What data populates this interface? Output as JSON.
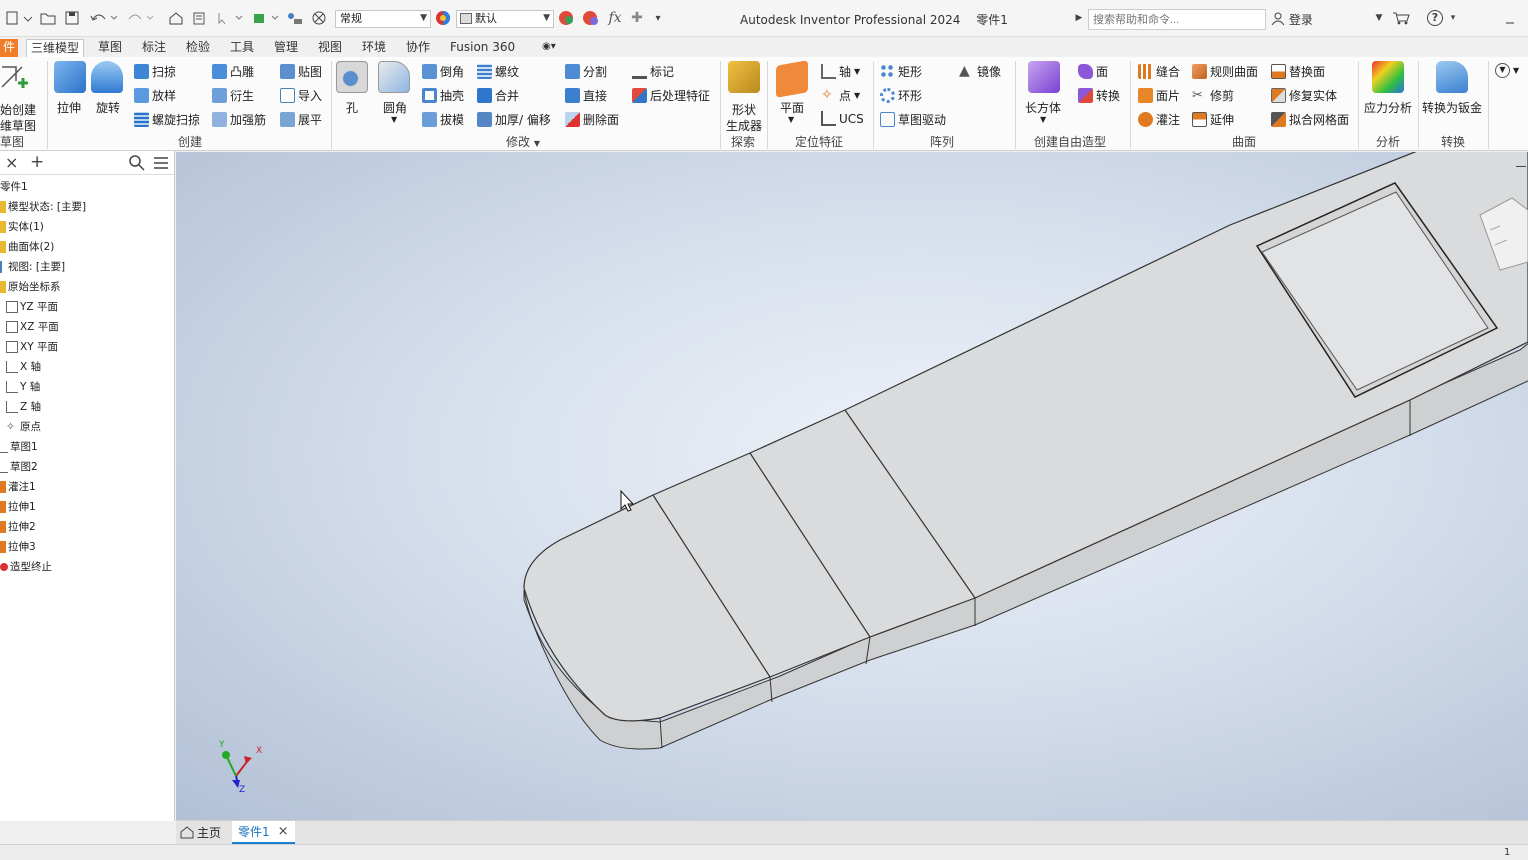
{
  "title": {
    "app": "Autodesk Inventor Professional 2024",
    "doc": "零件1"
  },
  "quick_access": {
    "appearance_combo": "常规",
    "material_combo": "默认",
    "search_placeholder": "搜索帮助和命令...",
    "login": "登录",
    "help": "?"
  },
  "tabs": [
    "件",
    "三维模型",
    "草图",
    "标注",
    "检验",
    "工具",
    "管理",
    "视图",
    "环境",
    "协作",
    "Fusion 360"
  ],
  "ribbon": {
    "sketch": {
      "label_line1": "始创建",
      "label_line2": "维草图",
      "group": "草图"
    },
    "create": {
      "group": "创建",
      "extrude": "拉伸",
      "revolve": "旋转",
      "sweep": "扫掠",
      "loft": "放样",
      "coil": "螺旋扫掠",
      "emboss": "凸雕",
      "derive": "衍生",
      "rib": "加强筋",
      "decal": "贴图",
      "import": "导入",
      "unwrap": "展平"
    },
    "modify": {
      "group": "修改",
      "hole": "孔",
      "fillet": "圆角",
      "chamfer": "倒角",
      "shell": "抽壳",
      "draft": "拔模",
      "thread": "螺纹",
      "combine": "合并",
      "thicken": "加厚/ 偏移",
      "split": "分割",
      "direct": "直接",
      "delete_face": "删除面",
      "mark": "标记",
      "post_feature": "后处理特征"
    },
    "explore": {
      "group": "探索",
      "shape_gen_1": "形状",
      "shape_gen_2": "生成器"
    },
    "work": {
      "group": "定位特征",
      "plane": "平面",
      "axis": "轴",
      "point": "点",
      "ucs": "UCS"
    },
    "pattern": {
      "group": "阵列",
      "rect": "矩形",
      "circ": "环形",
      "sketch_driven": "草图驱动",
      "mirror": "镜像"
    },
    "freeform": {
      "group": "创建自由造型",
      "box": "长方体",
      "face": "面",
      "convert": "转换"
    },
    "surface": {
      "group": "曲面",
      "stitch": "缝合",
      "patch": "面片",
      "sculpt": "灌注",
      "ruled": "规则曲面",
      "trim": "修剪",
      "extend": "延伸",
      "replace": "替换面",
      "repair": "修复实体",
      "fit_mesh": "拟合网格面"
    },
    "analysis": {
      "group": "分析",
      "stress": "应力分析"
    },
    "convert": {
      "group": "转换",
      "to_sheet": "转换为钣金"
    }
  },
  "browser": {
    "items": [
      "零件1",
      "模型状态: [主要]",
      "实体(1)",
      "曲面体(2)",
      "视图: [主要]",
      "原始坐标系",
      "YZ 平面",
      "XZ 平面",
      "XY 平面",
      "X 轴",
      "Y 轴",
      "Z 轴",
      "原点",
      "草图1",
      "草图2",
      "灌注1",
      "拉伸1",
      "拉伸2",
      "拉伸3",
      "造型终止"
    ]
  },
  "triad": {
    "x": "X",
    "y": "Y",
    "z": "Z"
  },
  "doc_tabs": {
    "home": "主页",
    "part": "零件1"
  },
  "status": {
    "count": "1"
  },
  "colors": {
    "file_tab": "#ef7d2a",
    "active_doc_tab": "#1a7fd4",
    "viewport_center": "#eef2f8",
    "viewport_edge": "#b2c0d6"
  }
}
